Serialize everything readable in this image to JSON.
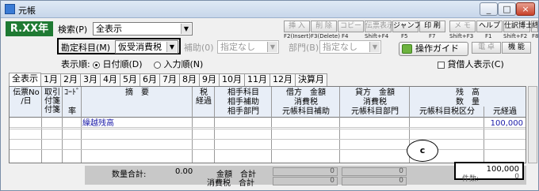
{
  "window": {
    "title": "元帳",
    "minimize": "_",
    "maximize": "□",
    "close": "×"
  },
  "period_badge": "R.XX年",
  "search": {
    "label": "検索(P)",
    "value": "全表示"
  },
  "account": {
    "label": "勘定科目(M)",
    "value": "仮受消費税"
  },
  "sub_account": {
    "label": "補助(0)",
    "value": "指定なし"
  },
  "department": {
    "label": "部門(B)",
    "value": "指定なし"
  },
  "display_order": {
    "label": "表示順:",
    "option1": "日付順(D)",
    "option2": "入力順(N)",
    "selected": "日付順(D)"
  },
  "lender_display": {
    "label": "貸借人表示(C)"
  },
  "operation_guide": "操作ガイド",
  "toolbar": [
    {
      "label": "挿 入",
      "key": "F2(Insert)",
      "enabled": false
    },
    {
      "label": "削 除",
      "key": "F3(Delete)",
      "enabled": false
    },
    {
      "label": "コピー",
      "key": "F4",
      "enabled": false
    },
    {
      "label": "伝票表示",
      "key": "Shift+F4",
      "enabled": false
    },
    {
      "label": "ジャンプ",
      "key": "F5",
      "enabled": true
    },
    {
      "label": "印 刷",
      "key": "F7",
      "enabled": true
    },
    {
      "label": "メ モ",
      "key": "Shift+F3",
      "enabled": false
    },
    {
      "label": "ヘルプ",
      "key": "F1",
      "enabled": true
    },
    {
      "label": "仕訳博士",
      "key": "Shift+F2",
      "enabled": true
    },
    {
      "label": "終 了",
      "key": "F8",
      "enabled": true
    }
  ],
  "sidebtns": {
    "b1": "電 卓",
    "b2": "機 能"
  },
  "tabs": [
    "全表示",
    "1月",
    "2月",
    "3月",
    "4月",
    "5月",
    "6月",
    "7月",
    "8月",
    "9月",
    "10月",
    "11月",
    "12月",
    "決算月"
  ],
  "headers": {
    "date": "伝票No\n/日",
    "torihiki": "取引\n付箋\n付箋",
    "code": "ｺｰﾄﾞ",
    "rate": "率",
    "summary": "摘　要",
    "tax": "税\n経過",
    "counter": "相手科目",
    "counter_sub": "相手補助",
    "counter_dept": "相手部門",
    "debit": "借方　金額",
    "debit_tax": "消費税",
    "debit_orig": "元帳科目補助",
    "credit": "貸方　金額",
    "credit_tax": "消費税",
    "credit_orig": "元帳科目部門",
    "balance": "残　高",
    "qty": "数　量",
    "orig_tax": "元帳科目税区分",
    "orig_elapsed": "元経過"
  },
  "rows": [
    {
      "summary": "繰越残高",
      "balance": "100,000"
    }
  ],
  "footer": {
    "qty_total_label": "数量合計:",
    "qty_total": "0.00",
    "amount_total_label": "金額　合計",
    "tax_total_label": "消費税　合計",
    "debit_total": "0",
    "credit_total": "0",
    "debit_tax_total": "0",
    "credit_tax_total": "0",
    "balance_total": "100,000",
    "count_label": "件数:",
    "count": "0"
  },
  "annotation": "c"
}
